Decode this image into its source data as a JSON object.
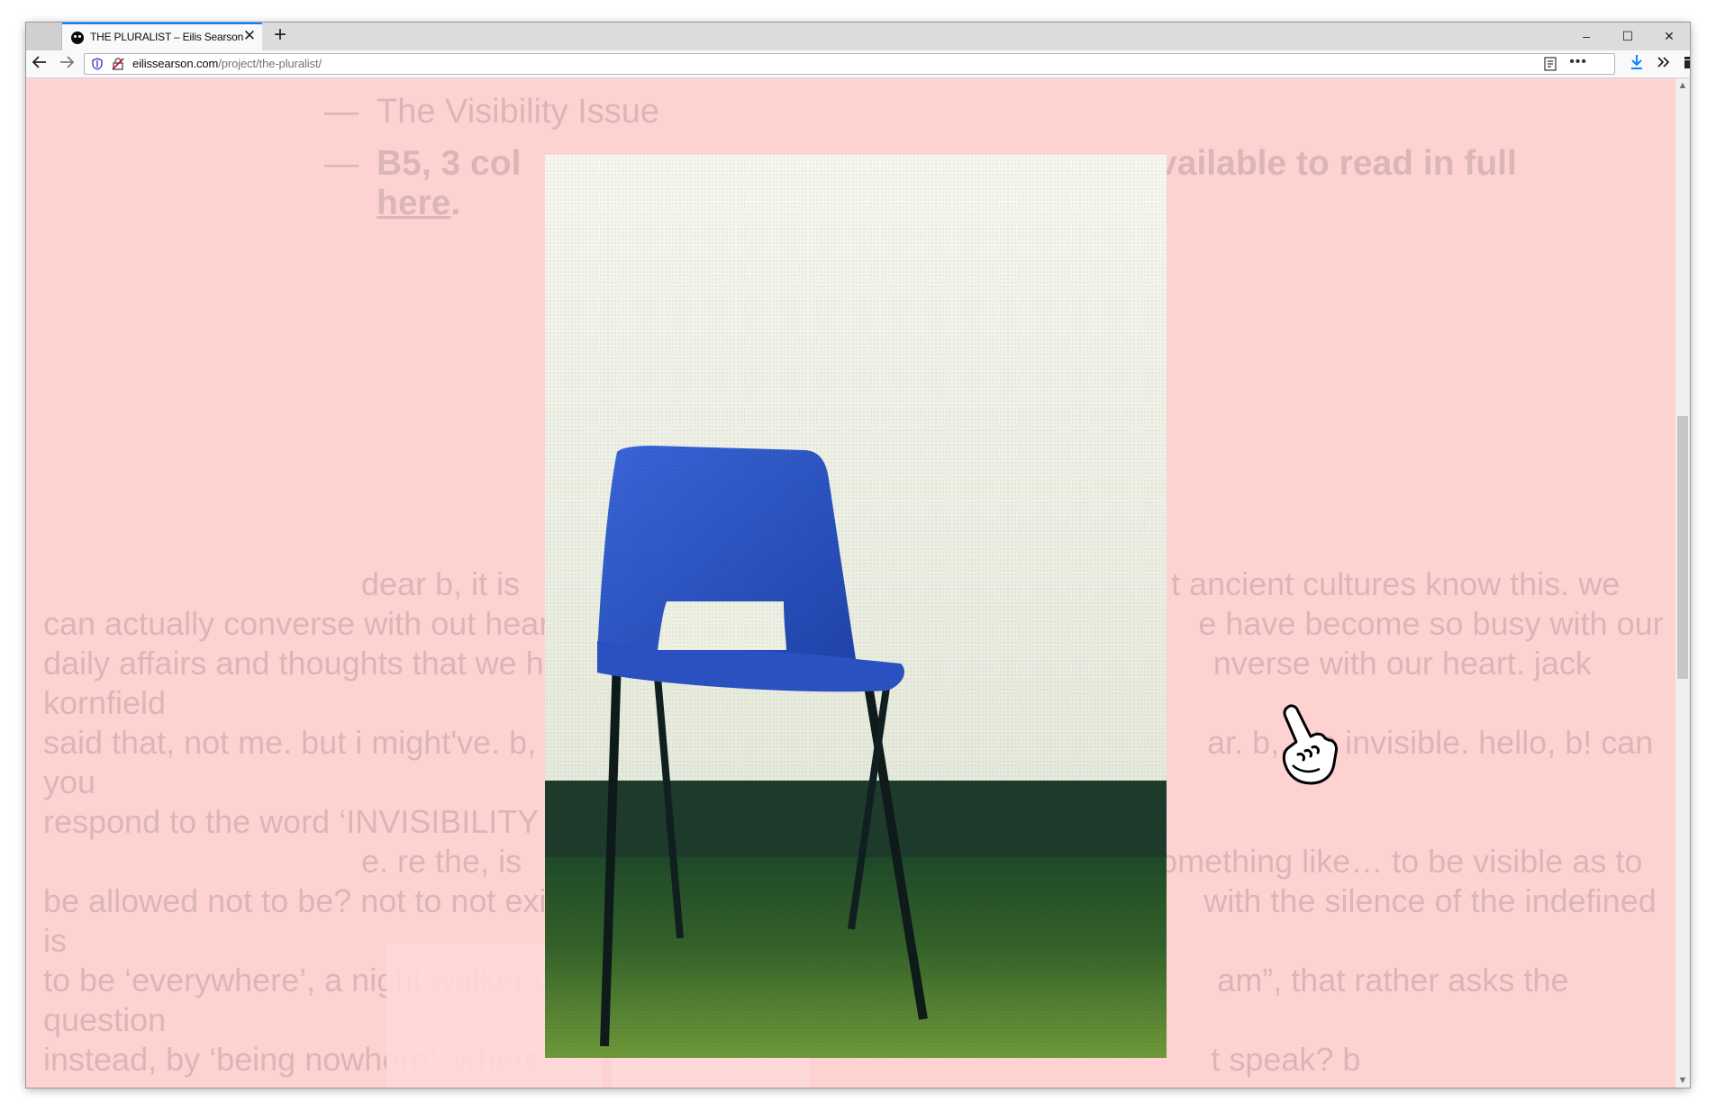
{
  "browser": {
    "tab_title": "THE PLURALIST – Eilis Searson",
    "new_tab_label": "+",
    "close_tab_label": "✕",
    "url_domain": "eilissearson.com",
    "url_path": "/project/the-pluralist/",
    "page_actions_label": "•••",
    "window_controls": {
      "minimize": "–",
      "maximize": "☐",
      "close": "✕"
    },
    "icons": [
      "back-arrow-icon",
      "forward-arrow-icon",
      "shield-icon",
      "insecure-lock-icon",
      "reader-view-icon",
      "download-icon",
      "overflow-chevrons-icon",
      "extensions-icon",
      "hamburger-menu-icon"
    ]
  },
  "page": {
    "issue_dash": "—",
    "issue_title": "The Visibility Issue",
    "format_dash": "—",
    "format_text_start": "B5, 3 col",
    "format_text_end": "available to read in full",
    "format_link": "here",
    "format_period": ".",
    "body_line_1a": "dear b, it is",
    "body_line_1b": "t ancient cultures know this. we",
    "body_line_2a": "can actually converse with out hear",
    "body_line_2b": "e have become so busy with our",
    "body_line_3a": "daily affairs and thoughts that we ha",
    "body_line_3b": "nverse with our heart. jack kornfield",
    "body_line_4a": "said that, not me. but i might've. b, i",
    "body_line_4b": "ar. b,, it's invisible. hello, b! can you",
    "body_line_5a": "respond to the word ‘INVISIBILITY",
    "body_line_6a": "e. re the, is",
    "body_line_6b": "something like… to be visible as to",
    "body_line_7a": "be allowed not to be? not to not exis",
    "body_line_7b": "with the silence of the indefined is",
    "body_line_8a": "to be ‘everywhere’, a night walker o",
    "body_line_8b": "am”, that rather asks the question",
    "body_line_9a": "instead, by ‘being nowhere’, where",
    "body_line_9b": "t speak? b"
  },
  "lightbox": {
    "subject": "blue plastic chair against white wall",
    "colors": {
      "wall": "#eef0e6",
      "chair": "#2d55c8",
      "floor": "#2f5a22",
      "skirting": "#1f3a2a"
    }
  },
  "colors": {
    "page_background": "#ffd2d2",
    "accent": "#0a84ff"
  }
}
